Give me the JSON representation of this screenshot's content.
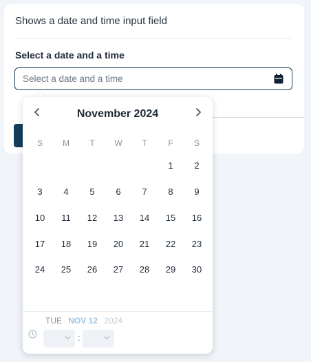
{
  "description": "Shows a date and time input field",
  "field": {
    "label": "Select a date and a time",
    "placeholder": "Select a date and a time"
  },
  "calendar": {
    "month_label": "November 2024",
    "weekdays": [
      "S",
      "M",
      "T",
      "W",
      "T",
      "F",
      "S"
    ],
    "weeks": [
      [
        "",
        "",
        "",
        "",
        "",
        "1",
        "2"
      ],
      [
        "3",
        "4",
        "5",
        "6",
        "7",
        "8",
        "9"
      ],
      [
        "10",
        "11",
        "12",
        "13",
        "14",
        "15",
        "16"
      ],
      [
        "17",
        "18",
        "19",
        "20",
        "21",
        "22",
        "23"
      ],
      [
        "24",
        "25",
        "26",
        "27",
        "28",
        "29",
        "30"
      ]
    ]
  },
  "time": {
    "weekday": "TUE",
    "month_day": "NOV 12",
    "year": "2024",
    "separator": ":"
  },
  "colors": {
    "accent": "#123c5a",
    "muted": "#8a94a0"
  },
  "icons": [
    "calendar-icon",
    "chevron-left-icon",
    "chevron-right-icon",
    "clock-icon",
    "chevron-down-icon"
  ]
}
